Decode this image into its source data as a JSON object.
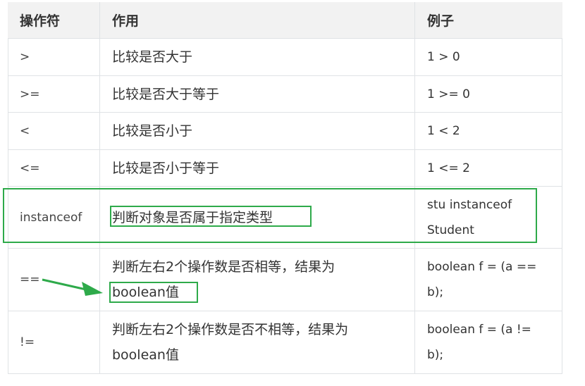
{
  "table": {
    "headers": [
      "操作符",
      "作用",
      "例子"
    ],
    "rows": [
      {
        "op": ">",
        "desc": "比较是否大于",
        "ex": "1 > 0"
      },
      {
        "op": ">=",
        "desc": "比较是否大于等于",
        "ex": "1 >= 0"
      },
      {
        "op": "<",
        "desc": "比较是否小于",
        "ex": "1 < 2"
      },
      {
        "op": "<=",
        "desc": "比较是否小于等于",
        "ex": "1 <= 2"
      },
      {
        "op": "instanceof",
        "desc": "判断对象是否属于指定类型",
        "ex_line1": "stu instanceof",
        "ex_line2": "Student"
      },
      {
        "op": "==",
        "desc_line1": "判断左右2个操作数是否相等，结果为",
        "desc_line2": "boolean值",
        "ex_line1": "boolean f = (a ==",
        "ex_line2": "b);"
      },
      {
        "op": "!=",
        "desc_line1": "判断左右2个操作数是否不相等，结果为",
        "desc_line2": "boolean值",
        "ex_line1": "boolean f = (a !=",
        "ex_line2": "b);"
      }
    ]
  },
  "annotations": {
    "highlight_color": "#2eaa4a"
  }
}
